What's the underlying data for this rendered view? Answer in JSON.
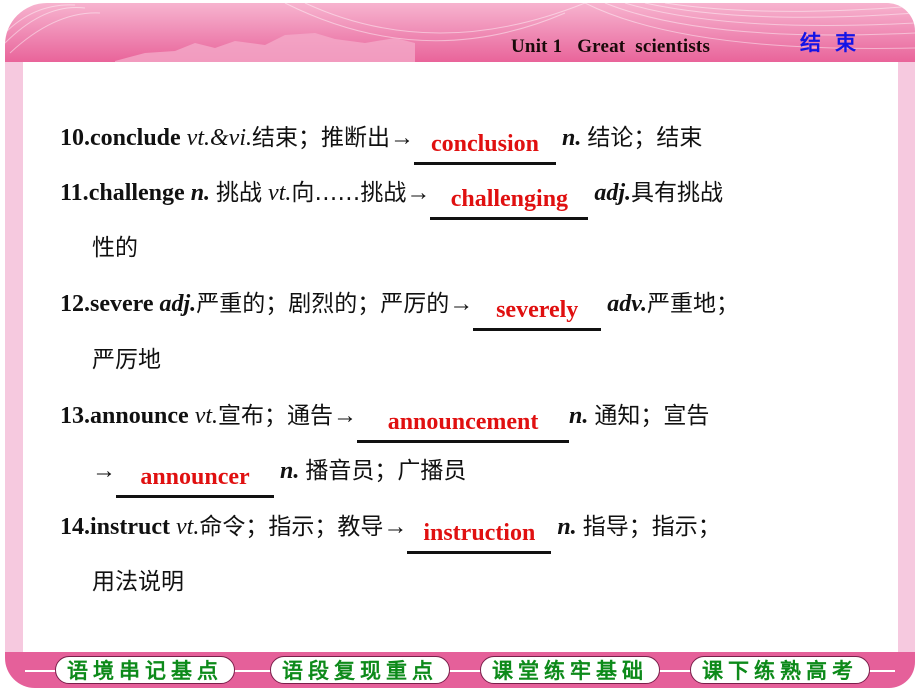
{
  "header": {
    "unit_title": "Unit 1   Great  scientists",
    "end_button": "结束"
  },
  "entries": [
    {
      "num": "10.",
      "word": "conclude",
      "pos": "vt.&vi.",
      "meaning": "结束；推断出",
      "arrow": "→",
      "answer": "conclusion",
      "answer_pos": "n.",
      "answer_meaning": "结论；结束"
    },
    {
      "num": "11.",
      "word": "challenge",
      "pos": "n.",
      "meaning": "挑战",
      "pos2": "vt.",
      "meaning2": "向……挑战",
      "arrow": "→",
      "answer": "challenging",
      "answer_pos": "adj.",
      "answer_meaning": "具有挑战",
      "continuation": "性的"
    },
    {
      "num": "12.",
      "word": "severe",
      "pos": "adj.",
      "meaning": "严重的；剧烈的；严厉的",
      "arrow": "→",
      "answer": "severely",
      "answer_pos": "adv.",
      "answer_meaning": "严重地；",
      "continuation": "严厉地"
    },
    {
      "num": "13.",
      "word": "announce",
      "pos": "vt.",
      "meaning": "宣布；通告",
      "arrow": "→",
      "answer": "announcement",
      "answer_pos": "n.",
      "answer_meaning": "通知；宣告",
      "arrow2": "→",
      "answer2": "announcer",
      "answer2_pos": "n.",
      "answer2_meaning": "播音员；广播员"
    },
    {
      "num": "14.",
      "word": "instruct",
      "pos": "vt.",
      "meaning": "命令；指示；教导",
      "arrow": "→",
      "answer": "instruction",
      "answer_pos": "n.",
      "answer_meaning": "指导；指示；",
      "continuation": "用法说明"
    }
  ],
  "footer_nav": [
    {
      "label": "语境串记基点"
    },
    {
      "label": "语段复现重点"
    },
    {
      "label": "课堂练牢基础"
    },
    {
      "label": "课下练熟高考"
    }
  ],
  "colors": {
    "header_pink": "#e9649a",
    "side_pink": "#f6c9df",
    "answer_red": "#e01010",
    "end_blue": "#1414e6",
    "nav_green": "#0d8a1a"
  }
}
